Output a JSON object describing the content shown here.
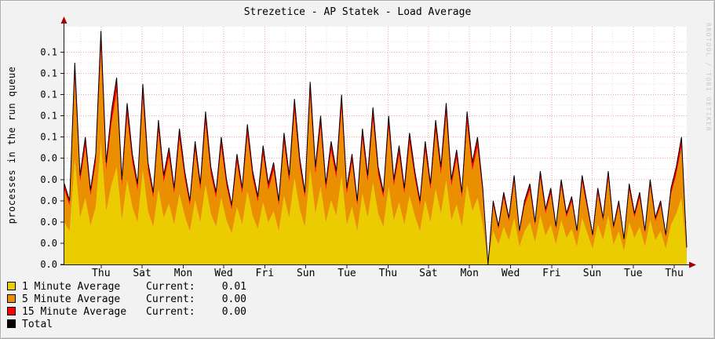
{
  "title": "Strezetice - AP Statek - Load Average",
  "y_axis_label": "processes in the run queue",
  "watermark": "RRDTOOL / TOBI OETIKER",
  "legend": {
    "items": [
      {
        "label": "1 Minute Average",
        "current_label": "Current:",
        "value": "0.01",
        "color": "#EACC00"
      },
      {
        "label": "5 Minute Average",
        "current_label": "Current:",
        "value": "0.00",
        "color": "#EA8F00"
      },
      {
        "label": "15 Minute Average",
        "current_label": "Current:",
        "value": "0.00",
        "color": "#FF0000"
      },
      {
        "label": "Total",
        "current_label": "",
        "value": "",
        "color": "#000000"
      }
    ]
  },
  "chart_data": {
    "type": "area",
    "title": "Strezetice - AP Statek - Load Average",
    "xlabel": "",
    "ylabel": "processes in the run queue",
    "ylim": [
      0,
      0.112
    ],
    "grid": true,
    "legend_position": "bottom-left",
    "plot": {
      "canvas_color": "#ffffff",
      "grid_minor": "#f7dada",
      "grid_major": "#f0a4a4",
      "axis_color": "#1a1a1a",
      "arrow_color": "#a40000"
    },
    "y_ticks": [
      {
        "value": 0.0,
        "label": "0.0"
      },
      {
        "value": 0.01,
        "label": "0.0"
      },
      {
        "value": 0.02,
        "label": "0.0"
      },
      {
        "value": 0.03,
        "label": "0.0"
      },
      {
        "value": 0.04,
        "label": "0.0"
      },
      {
        "value": 0.05,
        "label": "0.0"
      },
      {
        "value": 0.06,
        "label": "0.1"
      },
      {
        "value": 0.07,
        "label": "0.1"
      },
      {
        "value": 0.08,
        "label": "0.1"
      },
      {
        "value": 0.09,
        "label": "0.1"
      },
      {
        "value": 0.1,
        "label": "0.1"
      }
    ],
    "x_ticks": [
      {
        "label": "Thu",
        "frac": 0.059
      },
      {
        "label": "Sat",
        "frac": 0.125
      },
      {
        "label": "Mon",
        "frac": 0.191
      },
      {
        "label": "Wed",
        "frac": 0.256
      },
      {
        "label": "Fri",
        "frac": 0.322
      },
      {
        "label": "Sun",
        "frac": 0.388
      },
      {
        "label": "Tue",
        "frac": 0.454
      },
      {
        "label": "Thu",
        "frac": 0.52
      },
      {
        "label": "Sat",
        "frac": 0.585
      },
      {
        "label": "Mon",
        "frac": 0.651
      },
      {
        "label": "Wed",
        "frac": 0.717
      },
      {
        "label": "Fri",
        "frac": 0.783
      },
      {
        "label": "Sun",
        "frac": 0.848
      },
      {
        "label": "Tue",
        "frac": 0.914
      },
      {
        "label": "Thu",
        "frac": 0.98
      }
    ],
    "series_info": [
      {
        "name": "1 Minute Average",
        "color": "#EACC00",
        "style": "area-stack",
        "fraction_of_total": 0.52,
        "current": 0.01
      },
      {
        "name": "5 Minute Average",
        "color": "#EA8F00",
        "style": "area-stack",
        "fraction_of_total": 0.4,
        "current": 0.0
      },
      {
        "name": "15 Minute Average",
        "color": "#FF0000",
        "style": "area-stack",
        "fraction_of_total": 0.08,
        "current": 0.0
      },
      {
        "name": "Total",
        "color": "#000000",
        "style": "line"
      }
    ],
    "total": [
      0.038,
      0.03,
      0.095,
      0.042,
      0.06,
      0.035,
      0.052,
      0.11,
      0.048,
      0.072,
      0.088,
      0.04,
      0.076,
      0.052,
      0.038,
      0.085,
      0.048,
      0.034,
      0.068,
      0.042,
      0.055,
      0.036,
      0.064,
      0.044,
      0.03,
      0.058,
      0.038,
      0.072,
      0.046,
      0.034,
      0.06,
      0.04,
      0.028,
      0.052,
      0.036,
      0.066,
      0.044,
      0.032,
      0.056,
      0.038,
      0.048,
      0.03,
      0.062,
      0.042,
      0.078,
      0.05,
      0.034,
      0.086,
      0.046,
      0.07,
      0.038,
      0.058,
      0.044,
      0.08,
      0.036,
      0.052,
      0.03,
      0.064,
      0.042,
      0.074,
      0.046,
      0.034,
      0.07,
      0.04,
      0.056,
      0.036,
      0.062,
      0.044,
      0.03,
      0.058,
      0.038,
      0.068,
      0.046,
      0.076,
      0.04,
      0.054,
      0.034,
      0.072,
      0.048,
      0.06,
      0.036,
      0.0,
      0.03,
      0.018,
      0.034,
      0.022,
      0.042,
      0.016,
      0.03,
      0.038,
      0.02,
      0.044,
      0.026,
      0.036,
      0.018,
      0.04,
      0.024,
      0.032,
      0.016,
      0.042,
      0.028,
      0.014,
      0.036,
      0.022,
      0.044,
      0.018,
      0.03,
      0.012,
      0.038,
      0.024,
      0.034,
      0.016,
      0.04,
      0.022,
      0.03,
      0.014,
      0.036,
      0.046,
      0.06,
      0.008
    ]
  }
}
